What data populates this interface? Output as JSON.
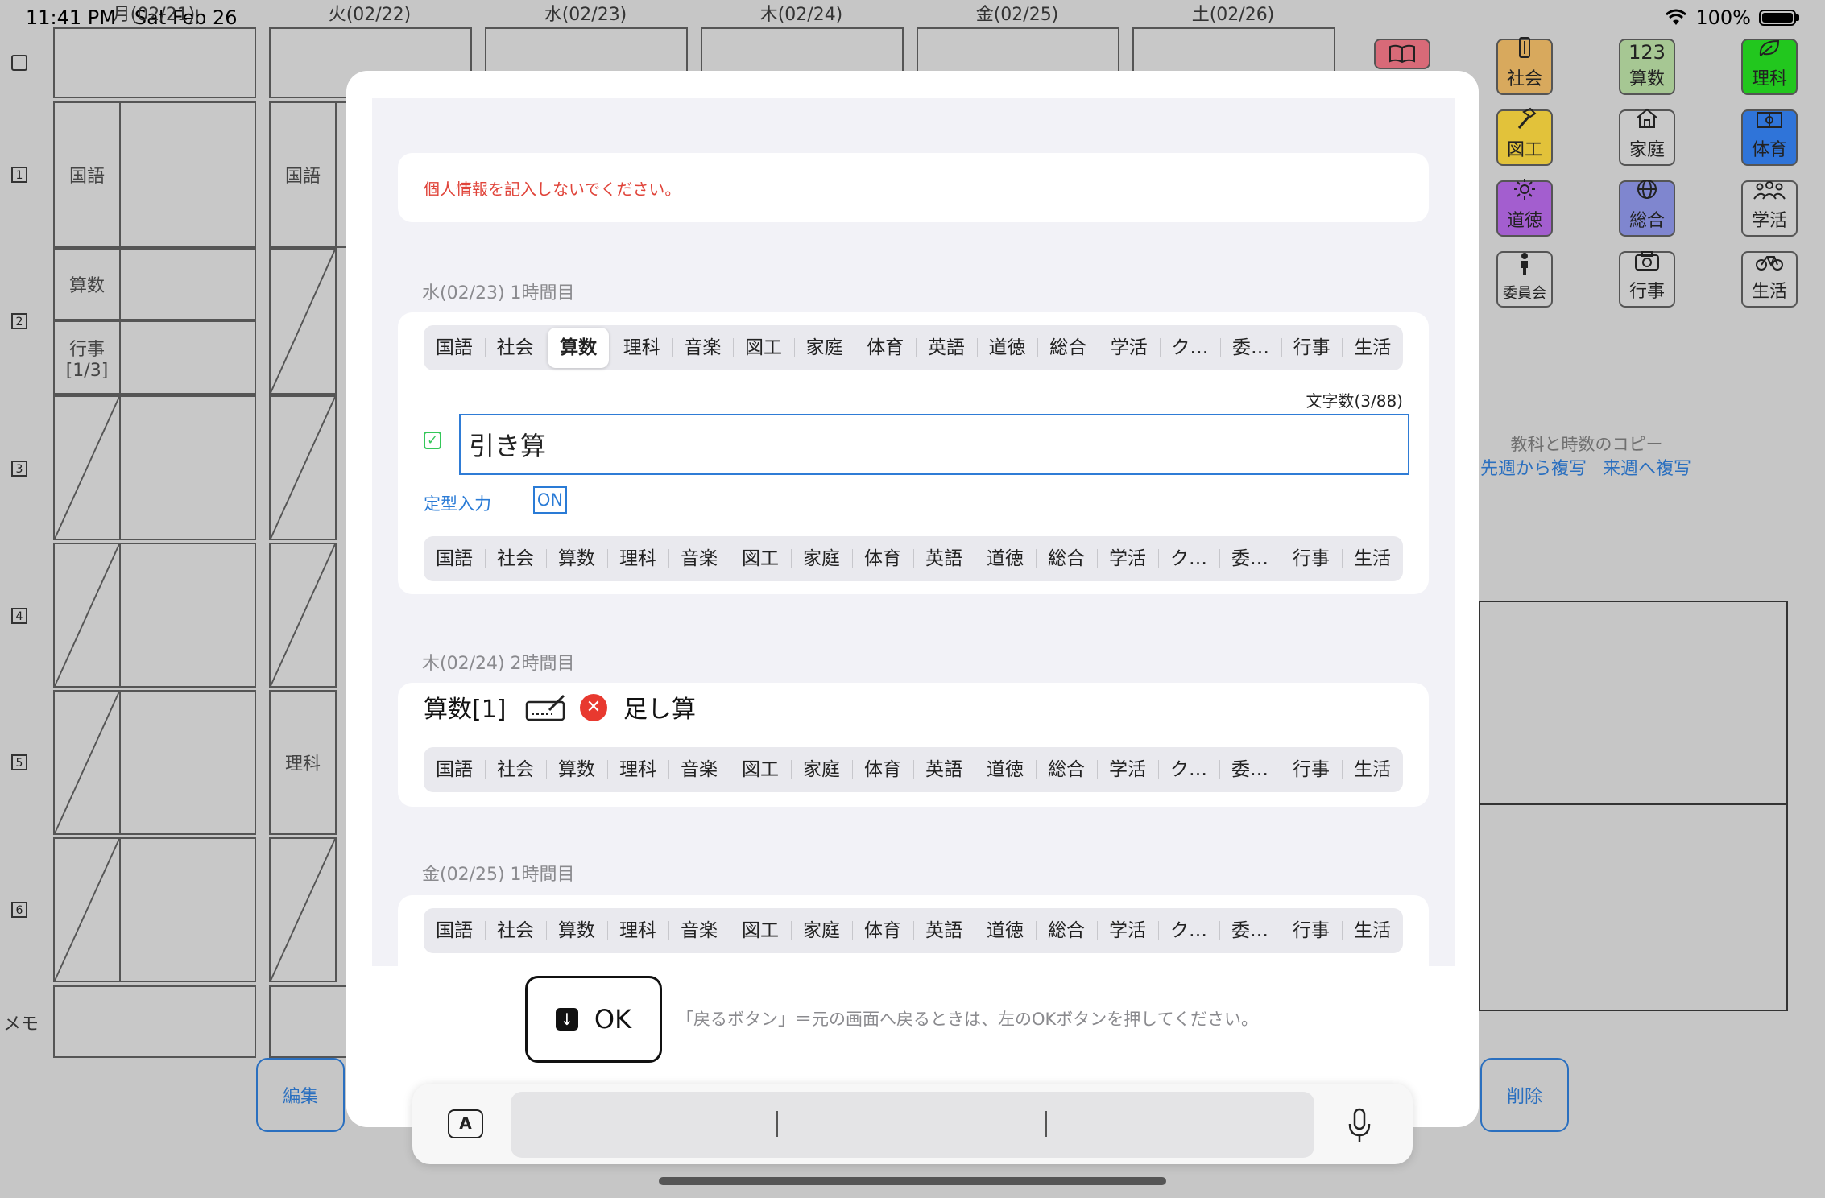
{
  "status_bar": {
    "time": "11:41 PM",
    "date": "Sat Feb 26",
    "battery": "100%"
  },
  "timetable": {
    "days": [
      "月(02/21)",
      "火(02/22)",
      "水(02/23)",
      "木(02/24)",
      "金(02/25)",
      "土(02/26)"
    ],
    "periods": [
      "1",
      "2",
      "3",
      "4",
      "5",
      "6"
    ],
    "memo_label": "メモ",
    "monday": {
      "p1": "国語",
      "p2a": "算数",
      "p2b": "行事\n[1/3]"
    },
    "tuesday": {
      "p1": "国語",
      "p5": "理科"
    },
    "edit_button": "編集",
    "delete_button": "削除",
    "copy": {
      "title": "教科と時数のコピー",
      "from_last": "先週から複写",
      "to_next": "来週へ複写"
    }
  },
  "palette": [
    {
      "label": "社会",
      "icon": "ruler-icon",
      "color": "#d8a95d"
    },
    {
      "label": "算数",
      "icon": "numbers-icon",
      "glyph": "123",
      "color": "#a6c793"
    },
    {
      "label": "理科",
      "icon": "leaf-icon",
      "color": "#22c71e"
    },
    {
      "label": "図工",
      "icon": "hammer-icon",
      "color": "#e2c23a"
    },
    {
      "label": "家庭",
      "icon": "house-icon",
      "color": "#c9c9c9"
    },
    {
      "label": "体育",
      "icon": "field-icon",
      "color": "#2f74d9"
    },
    {
      "label": "道徳",
      "icon": "sun-icon",
      "color": "#a35ecf"
    },
    {
      "label": "総合",
      "icon": "globe-icon",
      "color": "#7f86cf"
    },
    {
      "label": "学活",
      "icon": "people-icon",
      "color": "#c9c9c9"
    },
    {
      "label": "委員会",
      "icon": "person-icon",
      "color": "#c9c9c9"
    },
    {
      "label": "行事",
      "icon": "camera-icon",
      "color": "#c9c9c9"
    },
    {
      "label": "生活",
      "icon": "bicycle-icon",
      "color": "#c9c9c9"
    }
  ],
  "modal": {
    "notice": "個人情報を記入しないでください。",
    "subjects": [
      "国語",
      "社会",
      "算数",
      "理科",
      "音楽",
      "図工",
      "家庭",
      "体育",
      "英語",
      "道徳",
      "総合",
      "学活",
      "ク…",
      "委…",
      "行事",
      "生活"
    ],
    "section1": {
      "header": "水(02/23) 1時間目",
      "selected": "算数",
      "char_count": "文字数(3/88)",
      "text_value": "引き算",
      "template_label": "定型入力",
      "template_toggle": "ON"
    },
    "section2": {
      "header": "木(02/24) 2時間目",
      "subject": "算数[1]",
      "text": "足し算"
    },
    "section3": {
      "header": "金(02/25) 1時間目"
    },
    "ok_label": "OK",
    "hint": "「戻るボタン」＝元の画面へ戻るときは、左のOKボタンを押してください。"
  },
  "keyboard": {
    "format_icon": "A"
  }
}
